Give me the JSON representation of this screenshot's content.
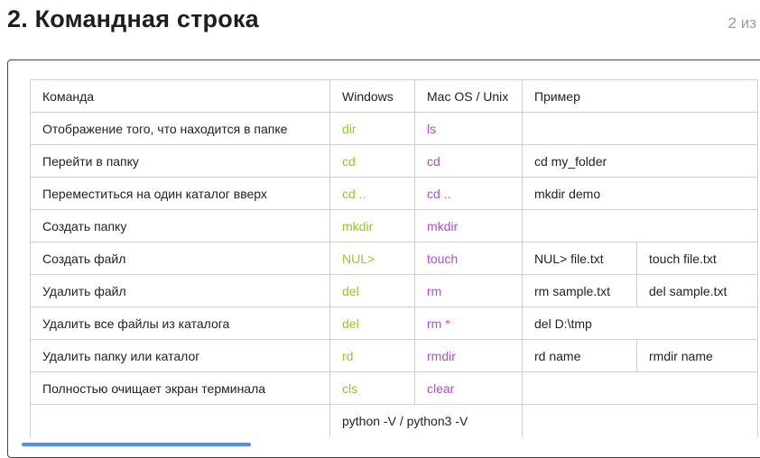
{
  "header": {
    "title": "2. Командная строка",
    "counter": "2 из"
  },
  "table": {
    "headers": [
      "Команда",
      "Windows",
      "Mac OS / Unix",
      "Пример"
    ],
    "rows": [
      {
        "desc": "Отображение того, что находится в папке",
        "win": "dir",
        "mac": "ls",
        "ex1": "",
        "ex2": ""
      },
      {
        "desc": "Перейти в папку",
        "win": "cd",
        "mac": "cd",
        "ex1": "cd my_folder",
        "ex2": ""
      },
      {
        "desc": "Переместиться на один каталог вверх",
        "win": "cd ..",
        "mac": "cd ..",
        "ex1": "mkdir demo",
        "ex2": ""
      },
      {
        "desc": "Создать папку",
        "win": "mkdir",
        "mac": "mkdir",
        "ex1": "",
        "ex2": ""
      },
      {
        "desc": "Создать файл",
        "win": "NUL>",
        "mac": "touch",
        "ex1": "NUL> file.txt",
        "ex2": "touch file.txt"
      },
      {
        "desc": "Удалить файл",
        "win": "del",
        "mac": "rm",
        "ex1": "rm sample.txt",
        "ex2": "del sample.txt"
      },
      {
        "desc": "Удалить все файлы из каталога",
        "win": "del",
        "mac": "rm *",
        "ex1": "del D:\\tmp",
        "ex2": ""
      },
      {
        "desc": "Удалить папку или каталог",
        "win": "rd",
        "mac": "rmdir",
        "ex1": "rd name",
        "ex2": "rmdir name"
      },
      {
        "desc": "Полностью очищает экран терминала",
        "win": "cls",
        "mac": "clear",
        "ex1": "",
        "ex2": ""
      }
    ],
    "partial_row": {
      "text": "python -V  /  python3 -V"
    }
  },
  "progress": {
    "fraction": 0.31
  },
  "colors": {
    "windows": "#8fce1a",
    "mac": "#b24bd6",
    "progress": "#4e8ef7"
  }
}
